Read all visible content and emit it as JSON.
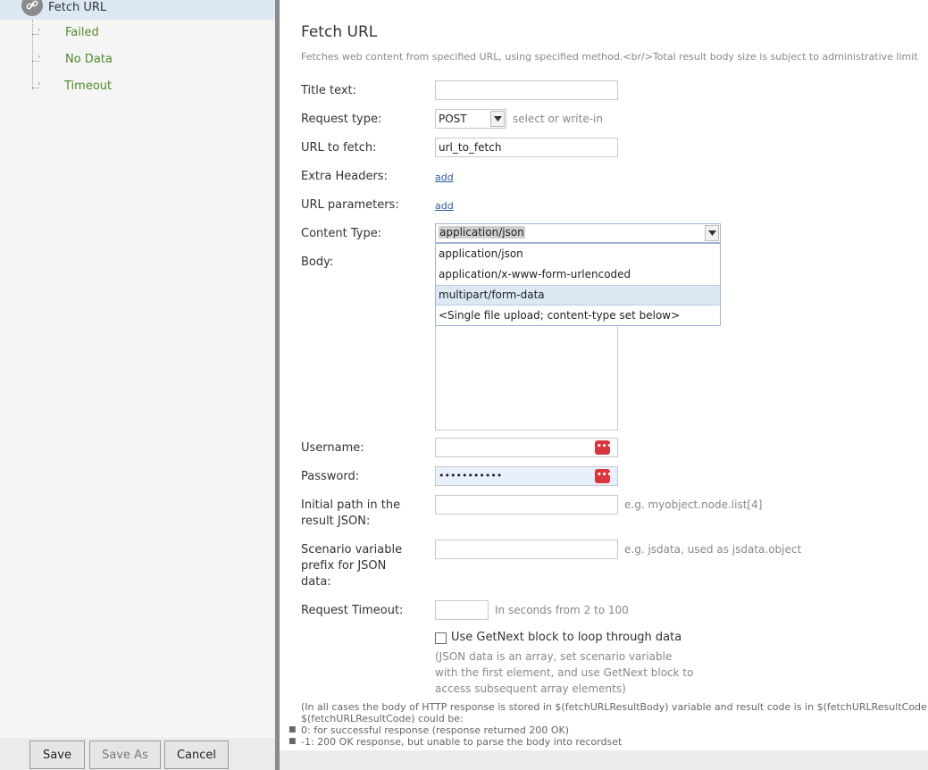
{
  "tree": {
    "root": "Fetch URL",
    "children": [
      "Failed",
      "No Data",
      "Timeout"
    ]
  },
  "buttons": {
    "save": "Save",
    "save_as": "Save As",
    "cancel": "Cancel"
  },
  "form": {
    "title": "Fetch URL",
    "description": "Fetches web content from specified URL, using specified method.<br/>Total result body size is subject to administrative limit",
    "labels": {
      "title_text": "Title text:",
      "request_type": "Request type:",
      "url_to_fetch": "URL to fetch:",
      "extra_headers": "Extra Headers:",
      "url_parameters": "URL parameters:",
      "content_type": "Content Type:",
      "body": "Body:",
      "username": "Username:",
      "password": "Password:",
      "initial_path": "Initial path in the result JSON:",
      "scenario_prefix": "Scenario variable prefix for JSON data:",
      "request_timeout": "Request Timeout:"
    },
    "request_type_value": "POST",
    "request_type_hint": "select or write-in",
    "url_value": "url_to_fetch",
    "add_link": "add",
    "content_type_value": "application/json",
    "content_type_options": [
      "application/json",
      "application/x-www-form-urlencoded",
      "multipart/form-data",
      "<Single file upload; content-type set below>"
    ],
    "password_value": "•••••••••••",
    "initial_path_hint": "e.g. myobject.node.list[4]",
    "prefix_hint": "e.g. jsdata, used as jsdata.object",
    "timeout_hint": "In seconds from 2 to 100",
    "getnext_label": "Use GetNext block to loop through data",
    "getnext_note": "(JSON data is an array, set scenario variable with the first element, and use GetNext block to access subsequent array elements)",
    "footer_line1": "(In all cases the body of HTTP response is stored in $(fetchURLResultBody) variable and result code is in $(fetchURLResultCode) variable.",
    "footer_line2": "$(fetchURLResultCode) could be:",
    "footer_items": [
      "0: for successful response (response returned 200 OK)",
      "-1: 200 OK response, but unable to parse the body into recordset"
    ]
  },
  "colors": {
    "accent": "#4f8a2b",
    "link": "#2a5aa0",
    "password_icon": "#d9363e"
  },
  "icons": {
    "root": "link-icon",
    "password": "password-manager-icon"
  }
}
